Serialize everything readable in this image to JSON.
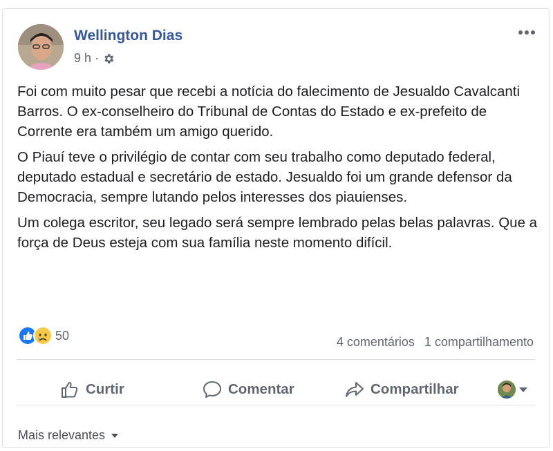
{
  "post": {
    "author": "Wellington Dias",
    "time": "9 h",
    "separator": "·",
    "privacy_icon": "gear-icon",
    "paragraphs": [
      "Foi com muito pesar que recebi a notícia do falecimento de Jesualdo Cavalcanti Barros. O ex-conselheiro do Tribunal de Contas do Estado e ex-prefeito de Corrente era também um amigo querido.",
      "O Piauí teve o privilégio de contar com seu trabalho como deputado federal, deputado estadual e secretário de estado. Jesualdo foi um grande defensor da Democracia, sempre lutando pelos interesses dos piauienses.",
      "Um colega escritor, seu legado será sempre lembrado pelas belas palavras. Que a força de Deus esteja com sua família neste momento difícil."
    ]
  },
  "stats": {
    "reaction_icons": [
      "like-icon",
      "sad-icon"
    ],
    "reaction_count": "50",
    "comments": "4 comentários",
    "shares": "1 compartilhamento"
  },
  "actions": {
    "like": "Curtir",
    "comment": "Comentar",
    "share": "Compartilhar"
  },
  "comments": {
    "sort_label": "Mais relevantes"
  },
  "colors": {
    "author_link": "#365899",
    "secondary_text": "#606770",
    "like_blue": "#1877f2",
    "sad_yellow": "#f7c94a"
  }
}
